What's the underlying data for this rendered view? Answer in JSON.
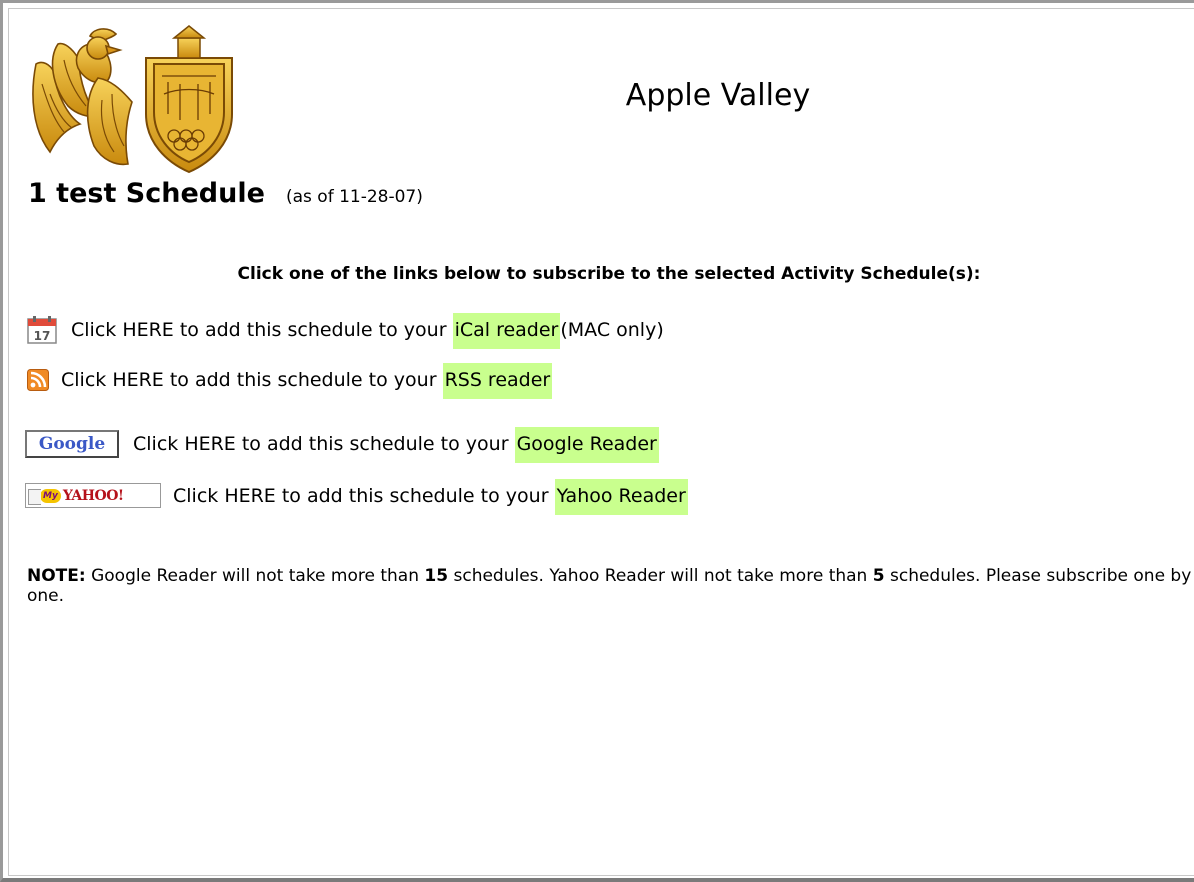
{
  "header": {
    "site_title": "Apple Valley"
  },
  "schedule": {
    "title": "1 test Schedule",
    "as_of": "(as of 11-28-07)"
  },
  "instructions": "Click one of the links below to subscribe to the selected Activity Schedule(s):",
  "subscribe_links": [
    {
      "icon": "calendar-icon",
      "prefix": "Click HERE to add this schedule to your",
      "link": "iCal reader",
      "suffix": "(MAC only)"
    },
    {
      "icon": "rss-icon",
      "prefix": "Click HERE to add this schedule to your",
      "link": "RSS reader",
      "suffix": ""
    },
    {
      "icon": "google-icon",
      "badge": "Google",
      "prefix": "Click HERE to add this schedule to your",
      "link": "Google Reader",
      "suffix": ""
    },
    {
      "icon": "my-yahoo-icon",
      "badge": "YAHOO!",
      "badge_my": "My",
      "prefix": "Click HERE to add this schedule to your",
      "link": "Yahoo Reader",
      "suffix": ""
    }
  ],
  "note": {
    "label": "NOTE:",
    "text1": "Google Reader will not take more than",
    "num1": "15",
    "text2": "schedules. Yahoo Reader will not take more than",
    "num2": "5",
    "text3": "schedules. Please subscribe one by one."
  },
  "colors": {
    "link_highlight": "#c9ff8e",
    "crest_gold": "#e2a414",
    "rss_orange": "#f08a24"
  }
}
